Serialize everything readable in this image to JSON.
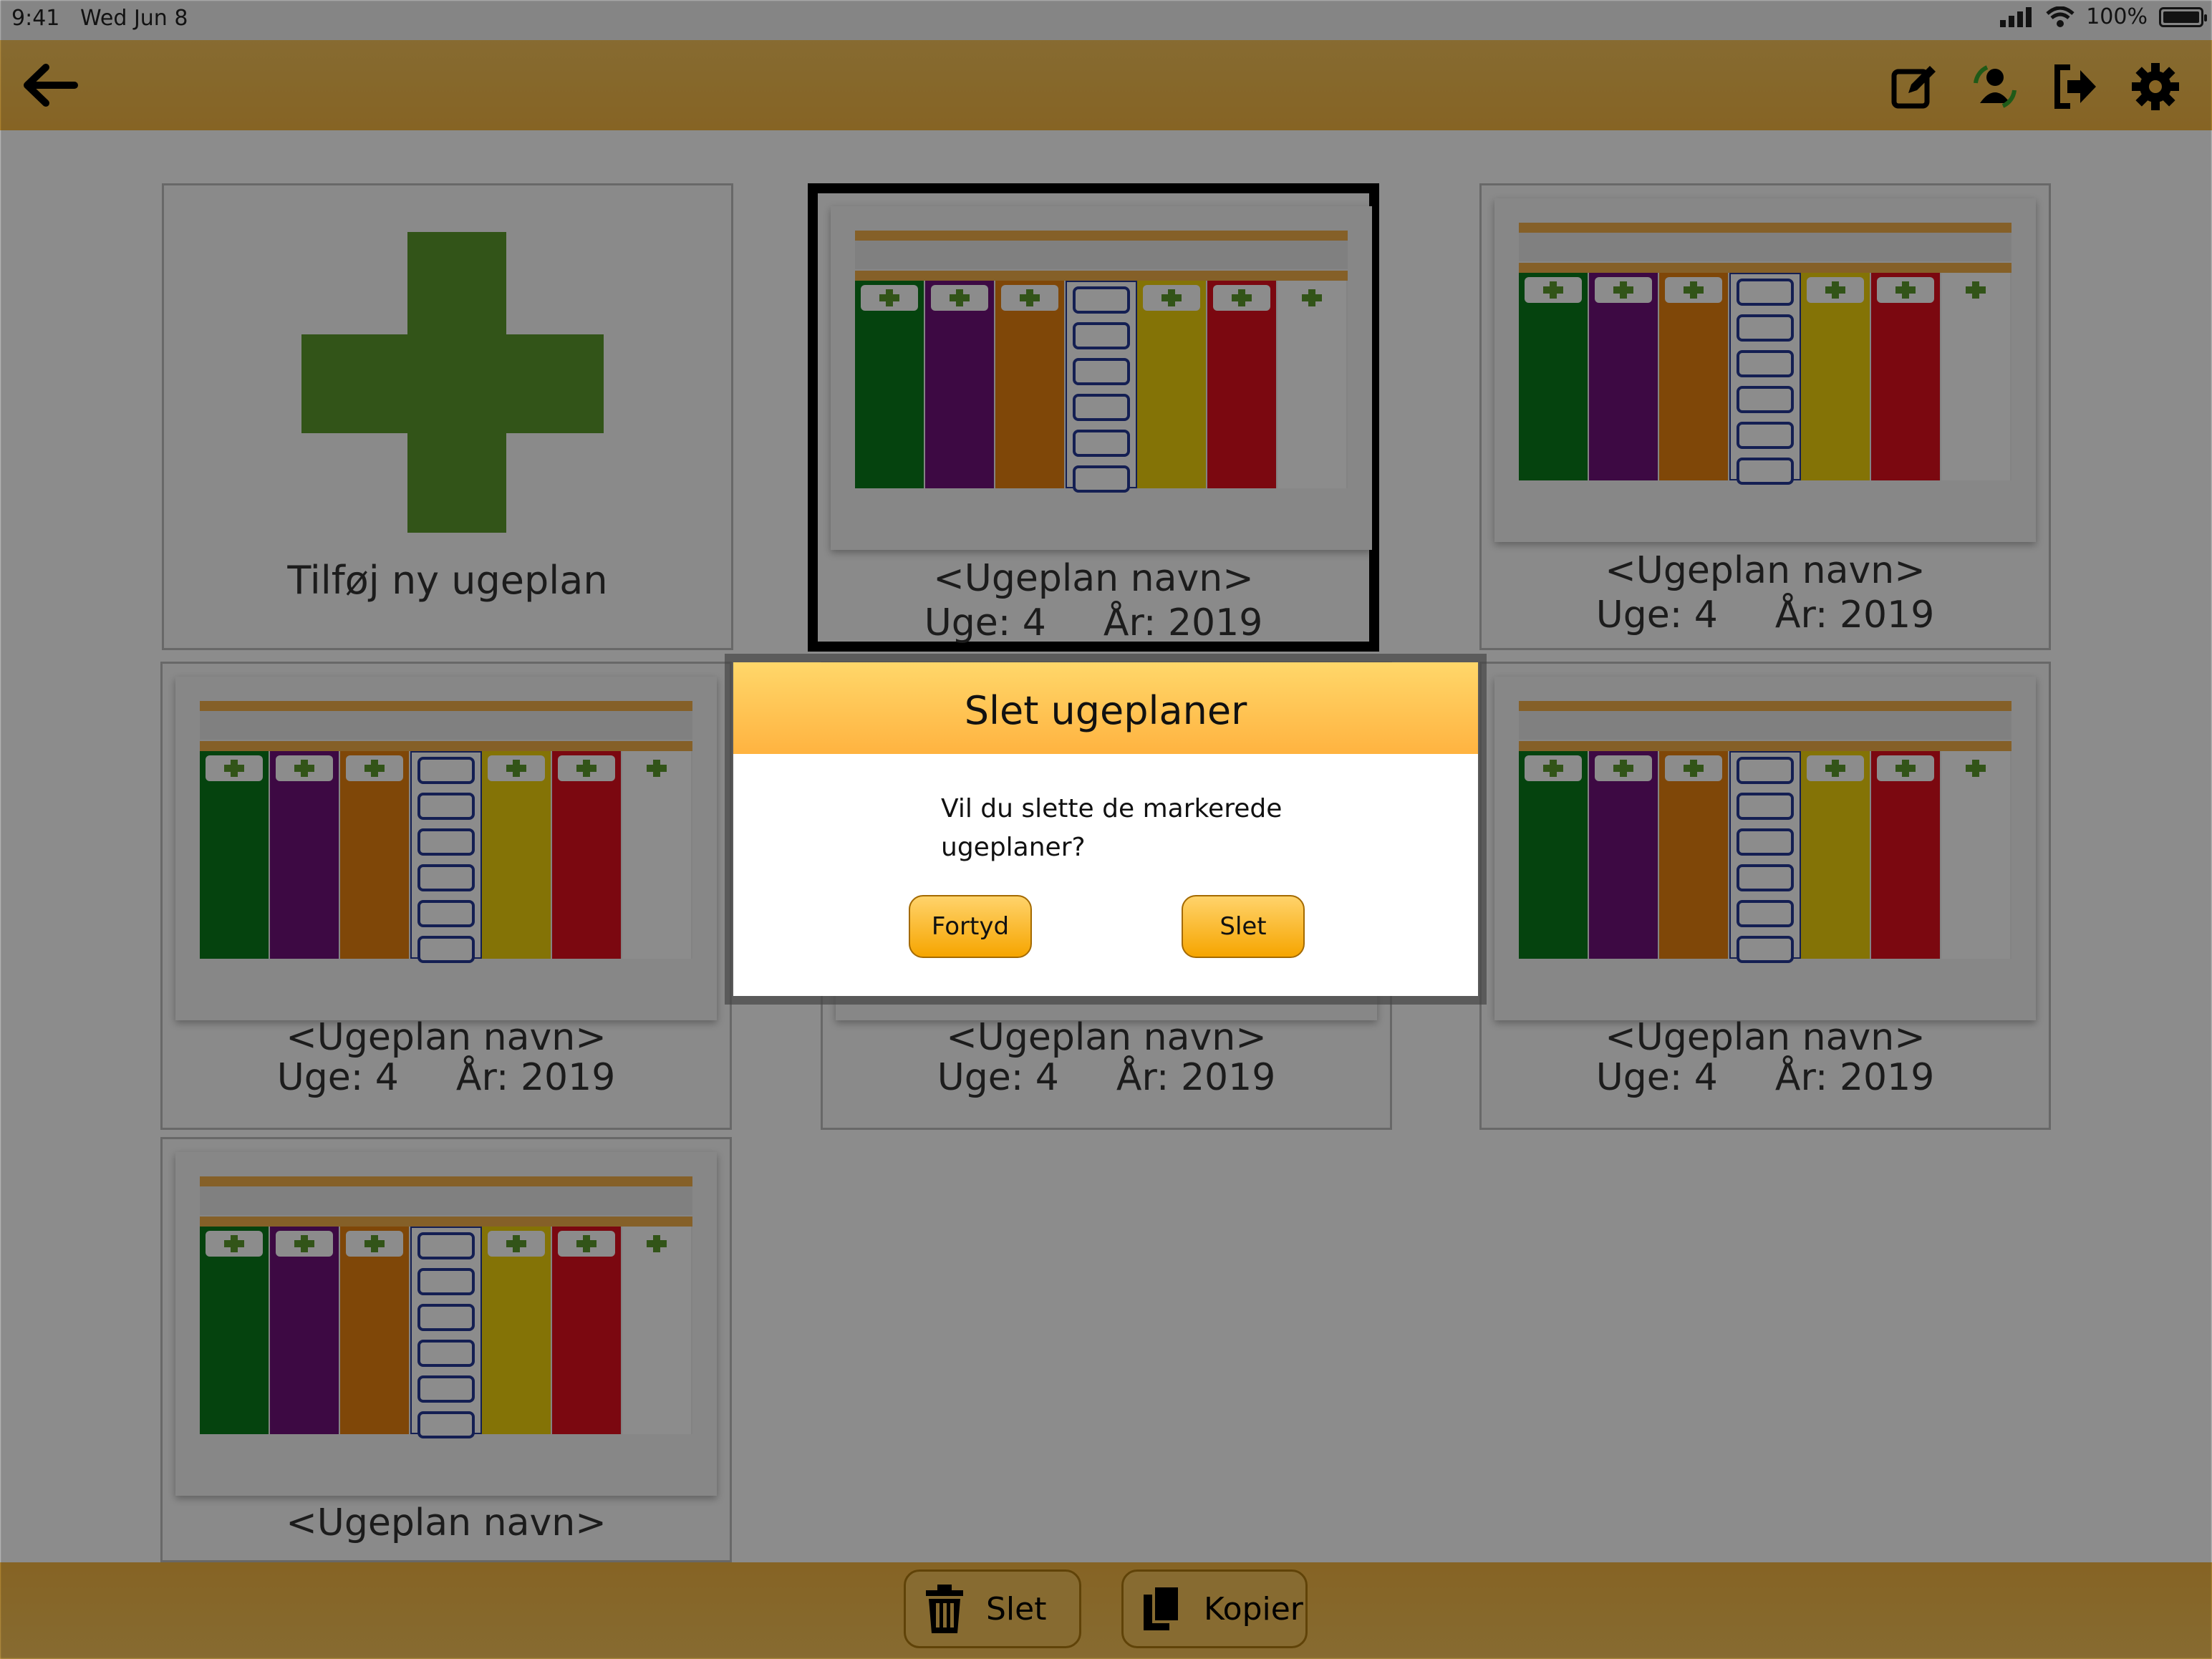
{
  "status_bar": {
    "time": "9:41",
    "date": "Wed Jun 8",
    "battery": "100%"
  },
  "tiles": {
    "add_label": "Tilføj ny ugeplan",
    "items": [
      {
        "name": "<Ugeplan navn>",
        "week": "Uge: 4",
        "year": "År: 2019"
      },
      {
        "name": "<Ugeplan navn>",
        "week": "Uge: 4",
        "year": "År: 2019"
      },
      {
        "name": "<Ugeplan navn>",
        "week": "Uge: 4",
        "year": "År: 2019"
      },
      {
        "name": "<Ugeplan navn>",
        "week": "Uge: 4",
        "year": "År: 2019"
      },
      {
        "name": "<Ugeplan navn>",
        "week": "Uge: 4",
        "year": "År: 2019"
      },
      {
        "name": "<Ugeplan navn>"
      }
    ]
  },
  "day_colors": [
    "#0a7a1a",
    "#6f117a",
    "#e8820f",
    "#ffffff",
    "#f0d10c",
    "#e0101e",
    "#ffffff"
  ],
  "bottom_bar": {
    "delete_label": "Slet",
    "copy_label": "Kopier"
  },
  "dialog": {
    "title": "Slet ugeplaner",
    "message_line1": "Vil du slette de markerede",
    "message_line2": "ugeplaner?",
    "cancel_label": "Fortyd",
    "confirm_label": "Slet"
  },
  "icons": [
    "back-arrow-icon",
    "edit-icon",
    "switch-user-icon",
    "logout-icon",
    "settings-icon",
    "trash-icon",
    "copy-icon"
  ]
}
